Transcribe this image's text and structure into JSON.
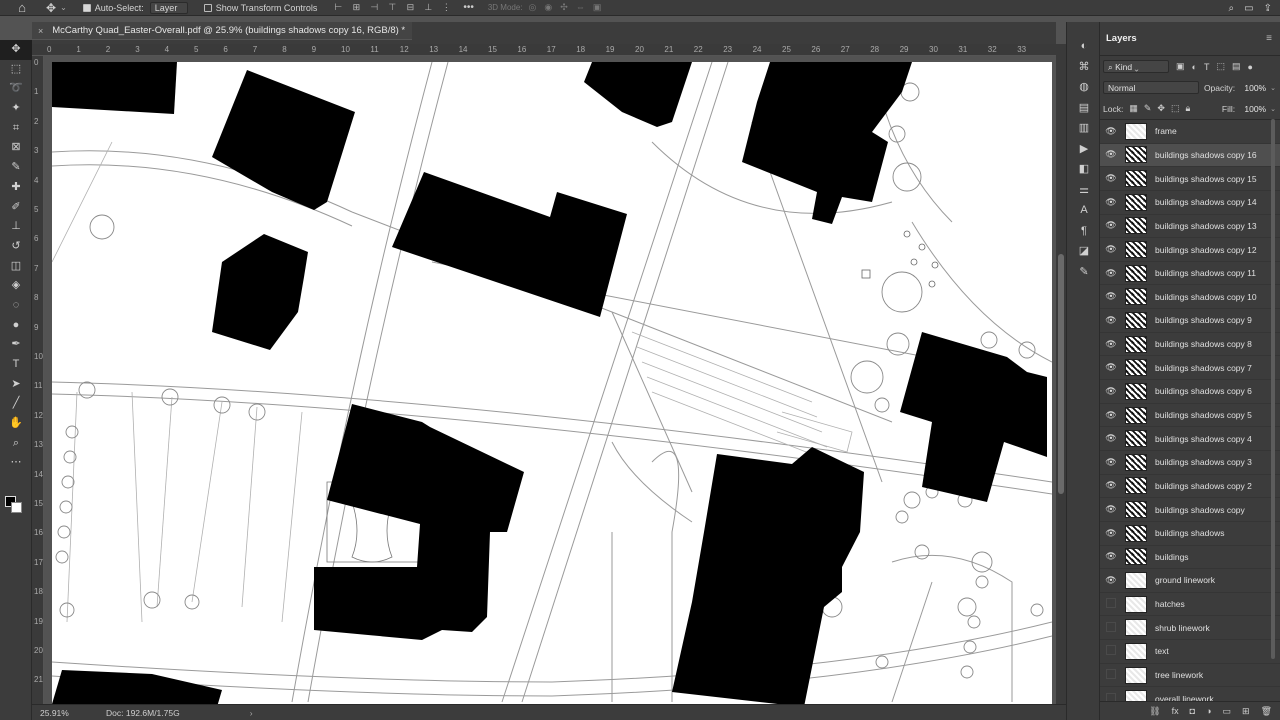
{
  "options_bar": {
    "home_icon": "home-icon",
    "move_tool_icon": "move-tool-icon",
    "auto_select_label": "Auto-Select:",
    "auto_select_checked": true,
    "auto_select_target": "Layer",
    "show_transform_label": "Show Transform Controls",
    "show_transform_checked": false,
    "more_icon": "•••",
    "mode_3d_label": "3D Mode:"
  },
  "document_tab": {
    "close_glyph": "×",
    "title": "McCarthy Quad_Easter-Overall.pdf @ 25.9% (buildings shadows copy 16, RGB/8) *"
  },
  "ruler_top": [
    "0",
    "1",
    "2",
    "3",
    "4",
    "5",
    "6",
    "7",
    "8",
    "9",
    "10",
    "11",
    "12",
    "13",
    "14",
    "15",
    "16",
    "17",
    "18",
    "19",
    "20",
    "21",
    "22",
    "23",
    "24",
    "25",
    "26",
    "27",
    "28",
    "29",
    "30",
    "31",
    "32",
    "33"
  ],
  "ruler_left": [
    "0",
    "1",
    "2",
    "3",
    "4",
    "5",
    "6",
    "7",
    "8",
    "9",
    "10",
    "11",
    "12",
    "13",
    "14",
    "15",
    "16",
    "17",
    "18",
    "19",
    "20",
    "21"
  ],
  "status": {
    "zoom": "25.91%",
    "doc": "Doc: 192.6M/1.75G",
    "arrow": "›"
  },
  "layers_panel": {
    "title": "Layers",
    "filter_label": "Kind",
    "blend_mode": "Normal",
    "opacity_label": "Opacity:",
    "opacity_value": "100%",
    "lock_label": "Lock:",
    "fill_label": "Fill:",
    "fill_value": "100%",
    "layers": [
      {
        "name": "frame",
        "visible": true,
        "thumb": "blank",
        "selected": false
      },
      {
        "name": "buildings shadows copy 16",
        "visible": true,
        "thumb": "shadow",
        "selected": true
      },
      {
        "name": "buildings shadows copy 15",
        "visible": true,
        "thumb": "shadow",
        "selected": false
      },
      {
        "name": "buildings shadows copy 14",
        "visible": true,
        "thumb": "shadow",
        "selected": false
      },
      {
        "name": "buildings shadows copy 13",
        "visible": true,
        "thumb": "shadow",
        "selected": false
      },
      {
        "name": "buildings shadows copy 12",
        "visible": true,
        "thumb": "shadow",
        "selected": false
      },
      {
        "name": "buildings shadows copy 11",
        "visible": true,
        "thumb": "shadow",
        "selected": false
      },
      {
        "name": "buildings shadows copy 10",
        "visible": true,
        "thumb": "shadow",
        "selected": false
      },
      {
        "name": "buildings shadows copy 9",
        "visible": true,
        "thumb": "shadow",
        "selected": false
      },
      {
        "name": "buildings shadows copy 8",
        "visible": true,
        "thumb": "shadow",
        "selected": false
      },
      {
        "name": "buildings shadows copy 7",
        "visible": true,
        "thumb": "shadow",
        "selected": false
      },
      {
        "name": "buildings shadows copy 6",
        "visible": true,
        "thumb": "shadow",
        "selected": false
      },
      {
        "name": "buildings shadows copy 5",
        "visible": true,
        "thumb": "shadow",
        "selected": false
      },
      {
        "name": "buildings shadows copy 4",
        "visible": true,
        "thumb": "shadow",
        "selected": false
      },
      {
        "name": "buildings shadows copy 3",
        "visible": true,
        "thumb": "shadow",
        "selected": false
      },
      {
        "name": "buildings shadows copy 2",
        "visible": true,
        "thumb": "shadow",
        "selected": false
      },
      {
        "name": "buildings shadows copy",
        "visible": true,
        "thumb": "shadow",
        "selected": false
      },
      {
        "name": "buildings shadows",
        "visible": true,
        "thumb": "shadow",
        "selected": false
      },
      {
        "name": "buildings",
        "visible": true,
        "thumb": "shadow",
        "selected": false
      },
      {
        "name": "ground linework",
        "visible": true,
        "thumb": "blank",
        "selected": false
      },
      {
        "name": "hatches",
        "visible": false,
        "thumb": "blank",
        "selected": false
      },
      {
        "name": "shrub linework",
        "visible": false,
        "thumb": "blank",
        "selected": false
      },
      {
        "name": "text",
        "visible": false,
        "thumb": "blank",
        "selected": false
      },
      {
        "name": "tree linework",
        "visible": false,
        "thumb": "blank",
        "selected": false
      },
      {
        "name": "overall linework",
        "visible": false,
        "thumb": "blank",
        "selected": false
      }
    ]
  }
}
